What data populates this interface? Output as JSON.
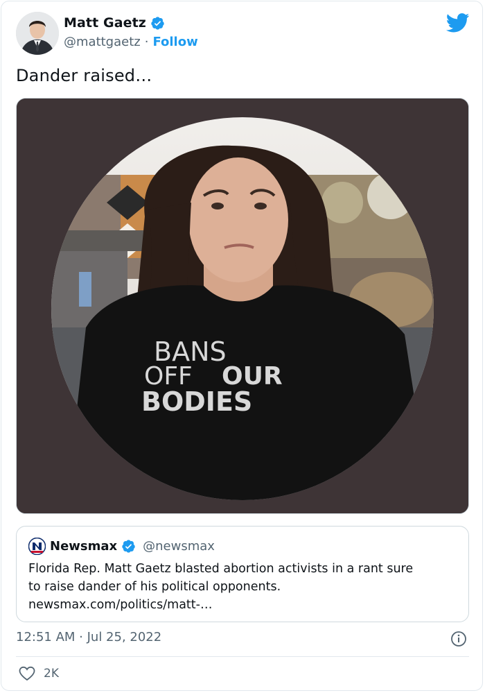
{
  "author": {
    "name": "Matt Gaetz",
    "handle": "@mattgaetz",
    "separator": "·",
    "follow_label": "Follow"
  },
  "tweet": {
    "text": "Dander raised…",
    "timestamp": "12:51 AM · Jul 25, 2022",
    "likes": "2K"
  },
  "media": {
    "shirt_line_1": "BANS",
    "shirt_line_2a": "OFF",
    "shirt_line_2b": "OUR",
    "shirt_line_3": "BODIES"
  },
  "quote": {
    "name": "Newsmax",
    "handle": "@newsmax",
    "body_lines": [
      "Florida Rep. Matt Gaetz blasted abortion activists in a rant sure",
      "to raise dander of his political opponents.",
      "newsmax.com/politics/matt-…"
    ]
  },
  "colors": {
    "accent": "#1d9bf0",
    "text": "#0f1419",
    "muted": "#536471",
    "border": "#cfd9de",
    "media_bg": "#3e3436",
    "newsmax_red": "#c8102e",
    "newsmax_blue": "#0b2a6b"
  },
  "icons": [
    "verified-badge-icon",
    "twitter-bird-icon",
    "info-icon",
    "heart-icon",
    "newsmax-logo"
  ]
}
